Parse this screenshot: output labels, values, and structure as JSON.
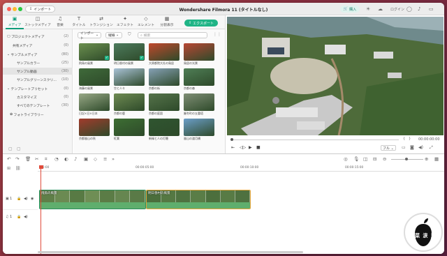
{
  "app": {
    "title": "Wondershare Filmora 11 (タイトルなし)",
    "import_label": "インポート",
    "buy_label": "購入",
    "login_label": "ログイン"
  },
  "tabs": [
    {
      "label": "メディア",
      "icon": "media-icon"
    },
    {
      "label": "ストックメディア",
      "icon": "stock-icon"
    },
    {
      "label": "音楽",
      "icon": "music-icon"
    },
    {
      "label": "タイトル",
      "icon": "title-icon"
    },
    {
      "label": "トランジション",
      "icon": "transition-icon"
    },
    {
      "label": "エフェクト",
      "icon": "effect-icon"
    },
    {
      "label": "エレメント",
      "icon": "element-icon"
    },
    {
      "label": "分割表示",
      "icon": "split-icon"
    }
  ],
  "export_label": "エクスポート",
  "sidebar": {
    "items": [
      {
        "label": "プロジェクトメディア",
        "count": "(2)"
      },
      {
        "label": "共有メディア",
        "count": "(0)"
      },
      {
        "label": "サンプルメディア",
        "count": "(80)"
      },
      {
        "label": "サンプルカラー",
        "count": "(25)"
      },
      {
        "label": "サンプル動画",
        "count": "(30)"
      },
      {
        "label": "サンプルグリーンスクリ...",
        "count": "(10)"
      },
      {
        "label": "テンプレートプリセット",
        "count": "(0)"
      },
      {
        "label": "カスタマイズ",
        "count": "(0)"
      },
      {
        "label": "すべてのテンプレート",
        "count": "(30)"
      },
      {
        "label": "フォトライブラリー",
        "count": ""
      }
    ]
  },
  "browser": {
    "import_dd": "インポート",
    "sort_dd": "縦線",
    "search_placeholder": "検索",
    "tiles": [
      {
        "caption": "飛鳥の風景",
        "color": "#6b8f4e",
        "checked": true
      },
      {
        "caption": "明日香村の風景",
        "color": "#4d7b5d",
        "checked": true
      },
      {
        "caption": "大原都院大社の鳥居",
        "color": "#c0482c",
        "checked": false
      },
      {
        "caption": "鳥居の光景",
        "color": "#b84734",
        "checked": false
      },
      {
        "caption": "海藤の風景",
        "color": "#3f6a3a",
        "checked": false
      },
      {
        "caption": "空と人々",
        "color": "#a9c2d6",
        "checked": false
      },
      {
        "caption": "京都の街",
        "color": "#86a1b6",
        "checked": false
      },
      {
        "caption": "京都の森",
        "color": "#4f7e56",
        "checked": false
      },
      {
        "caption": "日記×日×日本",
        "color": "#98a886",
        "checked": false
      },
      {
        "caption": "京都の鹿",
        "color": "#6e8a52",
        "checked": false
      },
      {
        "caption": "京都の庭園",
        "color": "#55734a",
        "checked": false
      },
      {
        "caption": "厳冬町の五重塔",
        "color": "#7f8e75",
        "checked": false
      },
      {
        "caption": "京都嵐山の秋",
        "color": "#a23b2c",
        "checked": false
      },
      {
        "caption": "紅葉",
        "color": "#3d6e33",
        "checked": false
      },
      {
        "caption": "新緑と人の灯籠",
        "color": "#2f5530",
        "checked": false
      },
      {
        "caption": "嵐山の渡月橋",
        "color": "#6b9ec9",
        "checked": false
      }
    ]
  },
  "preview": {
    "timecode": "00:00:00:00",
    "quality": "フル"
  },
  "timeline": {
    "ruler": [
      "00:00",
      "00:00:05:00",
      "00:00:10:00",
      "00:00:15:00"
    ],
    "clips": [
      {
        "label": "飛鳥の風景"
      },
      {
        "label": "明日香村の風景"
      }
    ],
    "tracks": [
      {
        "label": "1"
      },
      {
        "label": "1"
      }
    ]
  },
  "watermark": {
    "text": "菜 涙 活"
  }
}
